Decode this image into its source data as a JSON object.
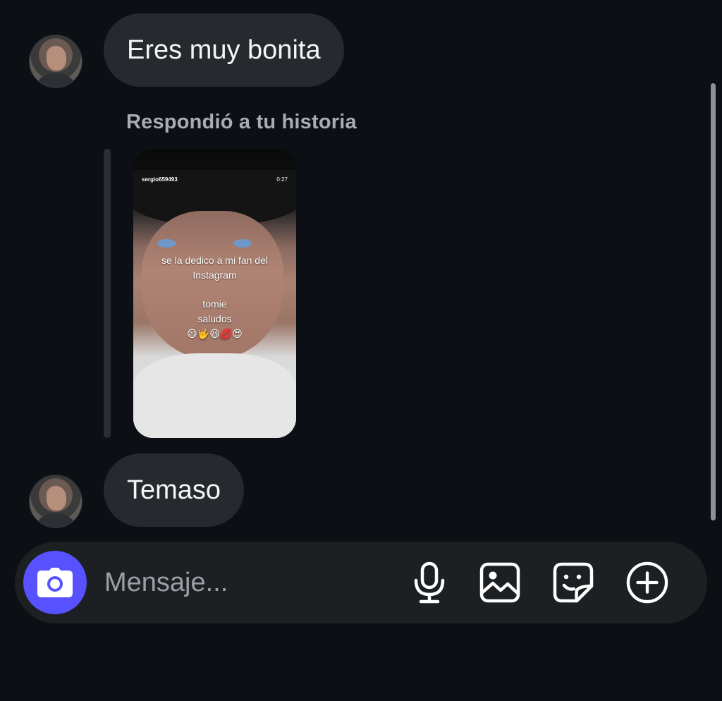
{
  "messages": [
    {
      "text": "Eres muy bonita"
    },
    {
      "text": "Temaso"
    }
  ],
  "story_reply": {
    "label": "Respondió a tu historia",
    "username": "sergio659493",
    "duration": "0:27",
    "overlay_lines": [
      "se la dedico a mi fan del",
      "Instagram",
      "",
      "tomie",
      "saludos",
      "😄🤟😆💋😍"
    ]
  },
  "composer": {
    "placeholder": "Mensaje..."
  },
  "icons": {
    "camera": "camera-icon",
    "microphone": "microphone-icon",
    "gallery": "gallery-icon",
    "sticker": "sticker-icon",
    "add": "plus-circle-icon"
  },
  "colors": {
    "background": "#0c1014",
    "bubble": "#262a2f",
    "composer": "#1c2023",
    "camera_button": "#5851ff"
  }
}
